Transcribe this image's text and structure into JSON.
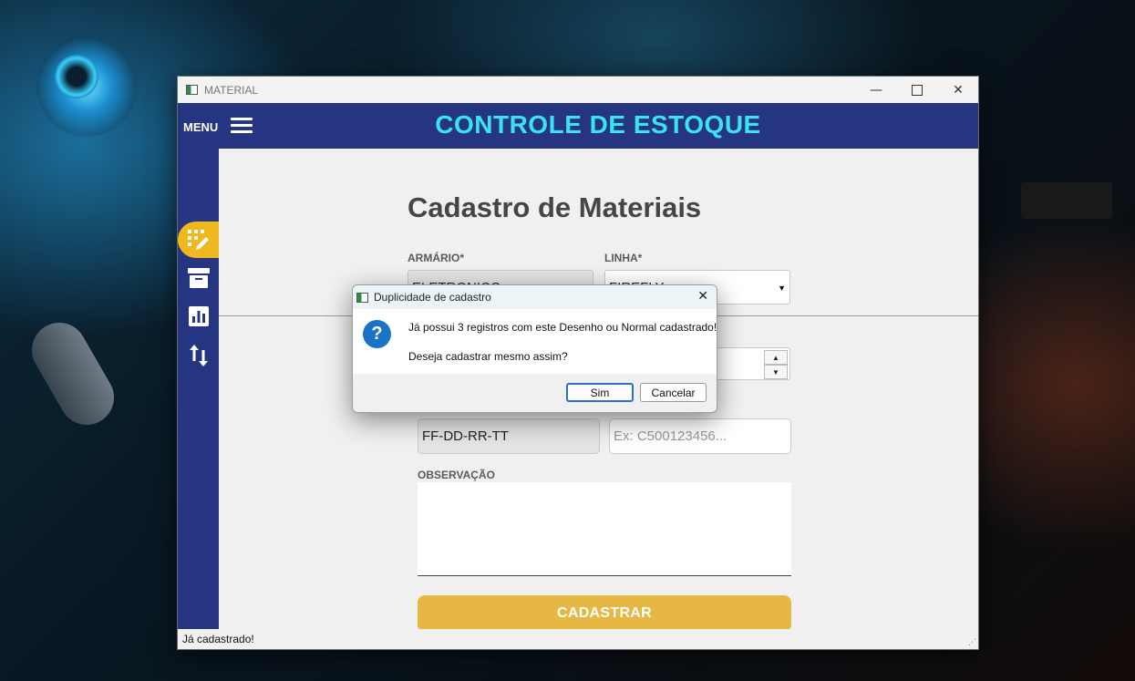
{
  "window": {
    "title": "MATERIAL",
    "minimize_glyph": "—",
    "maximize_glyph": "☐",
    "close_glyph": "✕"
  },
  "header": {
    "menu_label": "MENU",
    "app_title": "CONTROLE DE ESTOQUE"
  },
  "sidebar": {
    "items": [
      {
        "icon": "edit-list-icon",
        "active": true
      },
      {
        "icon": "archive-box-icon",
        "active": false
      },
      {
        "icon": "bar-chart-icon",
        "active": false
      },
      {
        "icon": "transfer-arrows-icon",
        "active": false
      }
    ]
  },
  "form": {
    "title": "Cadastro de Materiais",
    "armario_label": "ARMÁRIO*",
    "armario_value": "ELETRONICO",
    "linha_label": "LINHA*",
    "linha_value": "FIREFLY",
    "desenho_value": "FF-DD-RR-TT",
    "normal_placeholder": "Ex: C500123456...",
    "observacao_label": "OBSERVAÇÃO",
    "submit_label": "CADASTRAR"
  },
  "status": {
    "text": "Já cadastrado!"
  },
  "dialog": {
    "title": "Duplicidade de cadastro",
    "icon": "question-icon",
    "message_line1": "Já possui 3 registros com este Desenho ou Normal cadastrado!",
    "message_line2": "Deseja cadastrar mesmo assim?",
    "yes_label": "Sim",
    "cancel_label": "Cancelar",
    "close_glyph": "✕"
  },
  "colors": {
    "header_bg": "#253581",
    "title_color": "#39e3ef",
    "accent_yellow": "#e6b843",
    "active_sidebar": "#efb81f"
  }
}
